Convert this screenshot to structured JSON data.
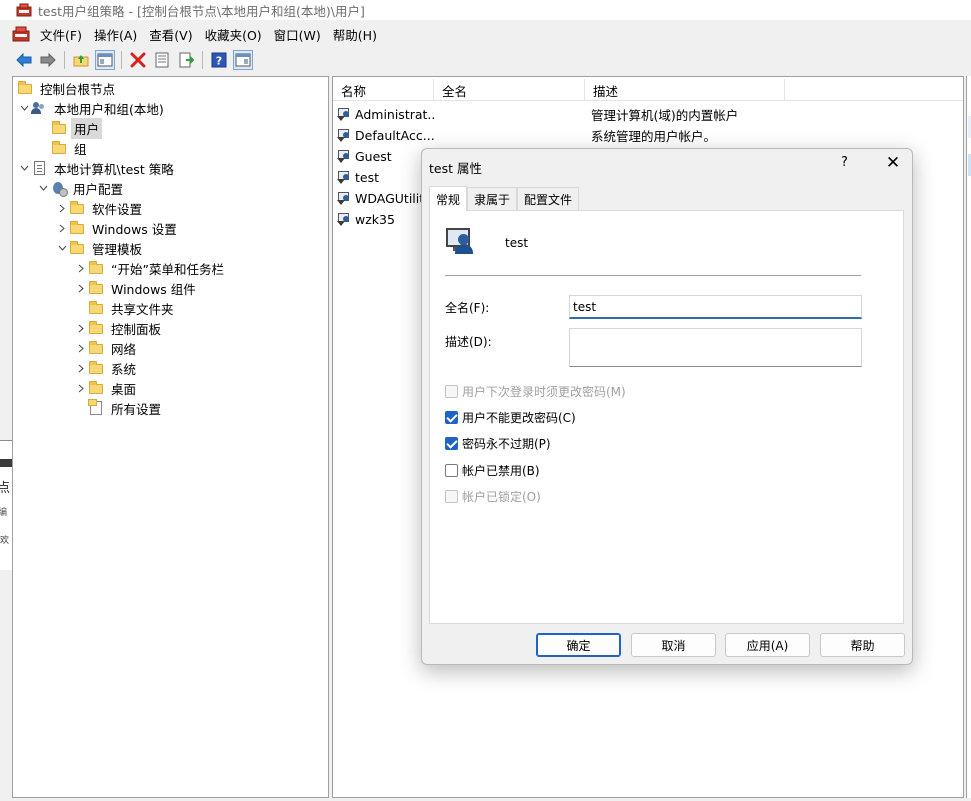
{
  "window": {
    "title": "test用户组策略 - [控制台根节点\\本地用户和组(本地)\\用户]"
  },
  "menu": [
    {
      "label": "文件(F)",
      "name": "file"
    },
    {
      "label": "操作(A)",
      "name": "action"
    },
    {
      "label": "查看(V)",
      "name": "view"
    },
    {
      "label": "收藏夹(O)",
      "name": "favorites"
    },
    {
      "label": "窗口(W)",
      "name": "window"
    },
    {
      "label": "帮助(H)",
      "name": "help"
    }
  ],
  "toolbar": {
    "icons": [
      "back-icon",
      "forward-icon",
      "up-folder-icon",
      "show-hide-tree-icon",
      "delete-icon",
      "properties-icon",
      "export-list-icon",
      "help-icon",
      "show-hide-action-pane-icon"
    ]
  },
  "tree": {
    "root": "控制台根节点",
    "local_users_groups": "本地用户和组(本地)",
    "users": "用户",
    "groups": "组",
    "local_policy": "本地计算机\\test 策略",
    "user_config": "用户配置",
    "software_settings": "软件设置",
    "windows_settings": "Windows 设置",
    "admin_templates": "管理模板",
    "start_menu": "“开始”菜单和任务栏",
    "windows_components": "Windows 组件",
    "shared_folders": "共享文件夹",
    "control_panel": "控制面板",
    "network": "网络",
    "system": "系统",
    "desktop": "桌面",
    "all_settings": "所有设置"
  },
  "list": {
    "columns": [
      "名称",
      "全名",
      "描述"
    ],
    "rows": [
      {
        "name": "Administrat...",
        "full": "",
        "desc": "管理计算机(域)的内置帐户"
      },
      {
        "name": "DefaultAcc...",
        "full": "",
        "desc": "系统管理的用户帐户。"
      },
      {
        "name": "Guest",
        "full": "",
        "desc": ""
      },
      {
        "name": "test",
        "full": "",
        "desc": ""
      },
      {
        "name": "WDAGUtilit",
        "full": "",
        "desc": ""
      },
      {
        "name": "wzk35",
        "full": "",
        "desc": ""
      }
    ]
  },
  "dialog": {
    "title": "test 属性",
    "help": "?",
    "close": "✕",
    "tabs": [
      "常规",
      "隶属于",
      "配置文件"
    ],
    "username": "test",
    "fullname_label": "全名(F):",
    "fullname_value": "test",
    "description_label": "描述(D):",
    "description_value": "",
    "checkboxes": [
      {
        "label": "用户下次登录时须更改密码(M)",
        "checked": false,
        "disabled": true
      },
      {
        "label": "用户不能更改密码(C)",
        "checked": true,
        "disabled": false
      },
      {
        "label": "密码永不过期(P)",
        "checked": true,
        "disabled": false
      },
      {
        "label": "帐户已禁用(B)",
        "checked": false,
        "disabled": false
      },
      {
        "label": "帐户已锁定(O)",
        "checked": false,
        "disabled": true
      }
    ],
    "buttons": {
      "ok": "确定",
      "cancel": "取消",
      "apply": "应用(A)",
      "help": "帮助"
    }
  },
  "background_scraps": {
    "t1": "点",
    "t2": "编",
    "t3": "欢"
  },
  "colors": {
    "accent": "#1f63c4",
    "selection": "#d9d9d9"
  }
}
